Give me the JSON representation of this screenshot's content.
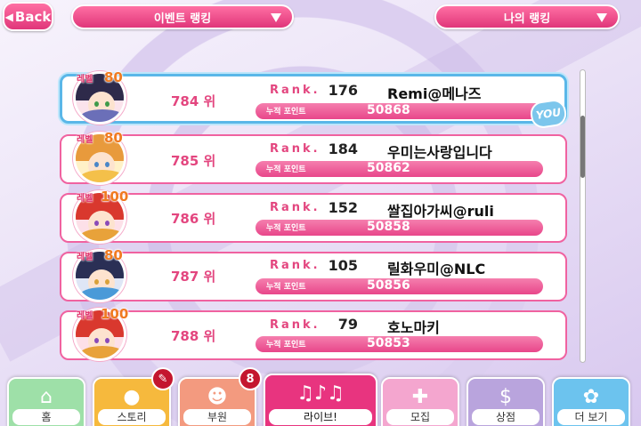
{
  "header": {
    "back_label": "Back",
    "event_ranking_label": "이벤트 랭킹",
    "my_ranking_label": "나의 랭킹"
  },
  "rows": [
    {
      "level_label": "레벨",
      "level": "80",
      "place": "784 위",
      "rank_label": "Rank.",
      "rank": "176",
      "name": "Remi@메나즈",
      "points_label": "누적 포인트",
      "points": "50868",
      "is_you": true
    },
    {
      "level_label": "레벨",
      "level": "80",
      "place": "785 위",
      "rank_label": "Rank.",
      "rank": "184",
      "name": "우미는사랑입니다",
      "points_label": "누적 포인트",
      "points": "50862",
      "is_you": false
    },
    {
      "level_label": "레벨",
      "level": "100",
      "place": "786 위",
      "rank_label": "Rank.",
      "rank": "152",
      "name": "쌀집아가씨@ruli",
      "points_label": "누적 포인트",
      "points": "50858",
      "is_you": false
    },
    {
      "level_label": "레벨",
      "level": "80",
      "place": "787 위",
      "rank_label": "Rank.",
      "rank": "105",
      "name": "릴화우미@NLC",
      "points_label": "누적 포인트",
      "points": "50856",
      "is_you": false
    },
    {
      "level_label": "레벨",
      "level": "100",
      "place": "788 위",
      "rank_label": "Rank.",
      "rank": "79",
      "name": "호노마키",
      "points_label": "누적 포인트",
      "points": "50853",
      "is_you": false
    }
  ],
  "you_badge": "YOU",
  "nav": {
    "tabs": [
      {
        "label": "홈",
        "icon": "home-icon",
        "color": "#9ee0a8"
      },
      {
        "label": "스토리",
        "icon": "chat-bubble-icon",
        "color": "#f6b93d"
      },
      {
        "label": "부원",
        "icon": "member-info-icon",
        "color": "#f39a7f"
      },
      {
        "label": "라이브!",
        "icon": "music-mic-icon",
        "color": "#e8347f"
      },
      {
        "label": "모집",
        "icon": "scout-plus-icon",
        "color": "#f4a6cf"
      },
      {
        "label": "상점",
        "icon": "shop-dollar-icon",
        "color": "#b9a4dd"
      },
      {
        "label": "더 보기",
        "icon": "gear-icon",
        "color": "#6cc3ee"
      }
    ],
    "story_badge_icon": "brush-icon",
    "member_badge_count": "8"
  },
  "colors": {
    "accent_pink": "#e8468a",
    "you_blue": "#5ab7e8"
  }
}
